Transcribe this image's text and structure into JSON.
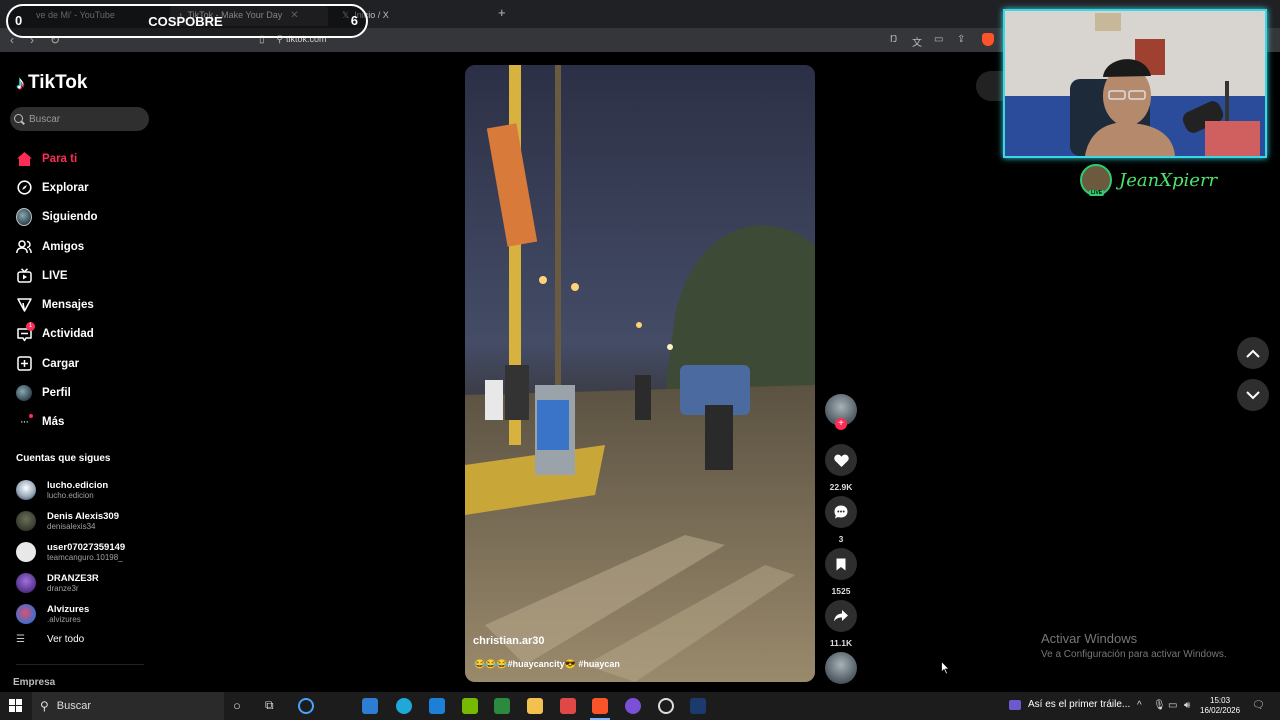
{
  "browser": {
    "tabs": [
      {
        "label": "ve de Mi' - YouTube"
      },
      {
        "label": "TikTok - Make Your Day",
        "active": true
      },
      {
        "label": "Inicio / X"
      }
    ],
    "url": "tiktok.com"
  },
  "scoreboard": {
    "left_score": "0",
    "title": "COSPOBRE",
    "right_score": "6"
  },
  "sidebar": {
    "logo": "TikTok",
    "search_placeholder": "Buscar",
    "nav": [
      {
        "label": "Para ti",
        "icon": "home-icon",
        "active": true
      },
      {
        "label": "Explorar",
        "icon": "compass-icon"
      },
      {
        "label": "Siguiendo",
        "icon": "avatar-icon"
      },
      {
        "label": "Amigos",
        "icon": "friends-icon"
      },
      {
        "label": "LIVE",
        "icon": "live-icon"
      },
      {
        "label": "Mensajes",
        "icon": "send-icon"
      },
      {
        "label": "Actividad",
        "icon": "inbox-icon",
        "badge": "1"
      },
      {
        "label": "Cargar",
        "icon": "upload-icon"
      },
      {
        "label": "Perfil",
        "icon": "profile-icon"
      },
      {
        "label": "Más",
        "icon": "more-icon"
      }
    ],
    "following_title": "Cuentas que sigues",
    "following": [
      {
        "name": "lucho.edicion",
        "handle": "lucho.edicion"
      },
      {
        "name": "Denis Alexis309",
        "handle": "denisalexis34"
      },
      {
        "name": "user07027359149",
        "handle": "teamcanguro.10198_"
      },
      {
        "name": "DRANZE3R",
        "handle": "dranze3r"
      },
      {
        "name": "Alvizures",
        "handle": ".alvizures"
      }
    ],
    "see_all": "Ver todo",
    "footer_section": "Empresa"
  },
  "video": {
    "author": "christian.ar30",
    "caption": "😂😂😂#huaycancity😎 #huaycan"
  },
  "actions": {
    "likes": "22.9K",
    "comments": "3",
    "saves": "1525",
    "shares": "11.1K"
  },
  "stream": {
    "streamer_name": "JeanXpierr",
    "live_badge": "LIVE"
  },
  "watermark": {
    "title": "Activar Windows",
    "subtitle": "Ve a Configuración para activar Windows."
  },
  "taskbar": {
    "search_placeholder": "Buscar",
    "news": "Así es el primer tráile...",
    "time": "15:03",
    "date": "16/02/2026"
  },
  "colors": {
    "accent": "#fe2c55",
    "webcam_border": "#39d8e6",
    "streamer_name": "#4be36b"
  }
}
